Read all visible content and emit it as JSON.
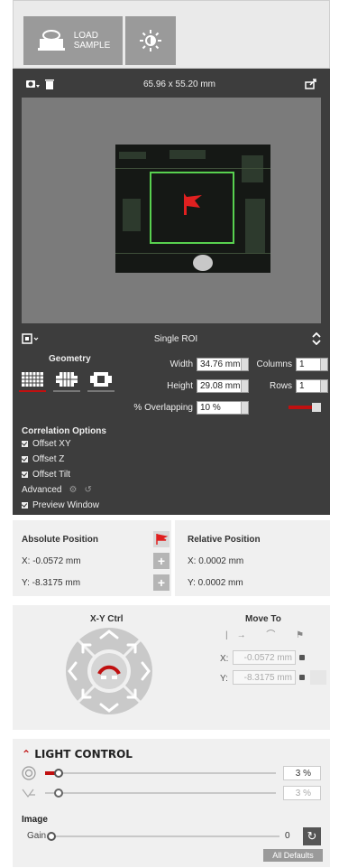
{
  "toolbar": {
    "load_sample_line1": "LOAD",
    "load_sample_line2": "SAMPLE"
  },
  "camera": {
    "dimensions": "65.96 x 55.20 mm"
  },
  "roi": {
    "mode": "Single ROI",
    "geometry_label": "Geometry",
    "width_label": "Width",
    "width_value": "34.76 mm",
    "height_label": "Height",
    "height_value": "29.08 mm",
    "overlap_label": "% Overlapping",
    "overlap_value": "10 %",
    "columns_label": "Columns",
    "columns_value": "1",
    "rows_label": "Rows",
    "rows_value": "1"
  },
  "correlation": {
    "title": "Correlation Options",
    "offset_xy": "Offset XY",
    "offset_z": "Offset Z",
    "offset_tilt": "Offset Tilt",
    "advanced": "Advanced",
    "preview": "Preview Window"
  },
  "position": {
    "absolute_title": "Absolute Position",
    "abs_x": "X: -0.0572 mm",
    "abs_y": "Y: -8.3175 mm",
    "relative_title": "Relative Position",
    "rel_x": "X: 0.0002 mm",
    "rel_y": "Y: 0.0002 mm"
  },
  "xy": {
    "title": "X-Y Ctrl",
    "move_to": "Move To",
    "x_label": "X:",
    "y_label": "Y:",
    "x_value": "-0.0572 mm",
    "y_value": "-8.3175 mm"
  },
  "light": {
    "title": "LIGHT CONTROL",
    "slider1_value": "3 %",
    "slider1_level": 0.04,
    "slider2_value": "3 %",
    "image_title": "Image",
    "gain_label": "Gain",
    "gain_value": "0",
    "all_defaults": "All Defaults"
  },
  "colors": {
    "accent": "#c01010",
    "dark_panel": "#3d3d3d",
    "roi_box": "#58d04f"
  }
}
